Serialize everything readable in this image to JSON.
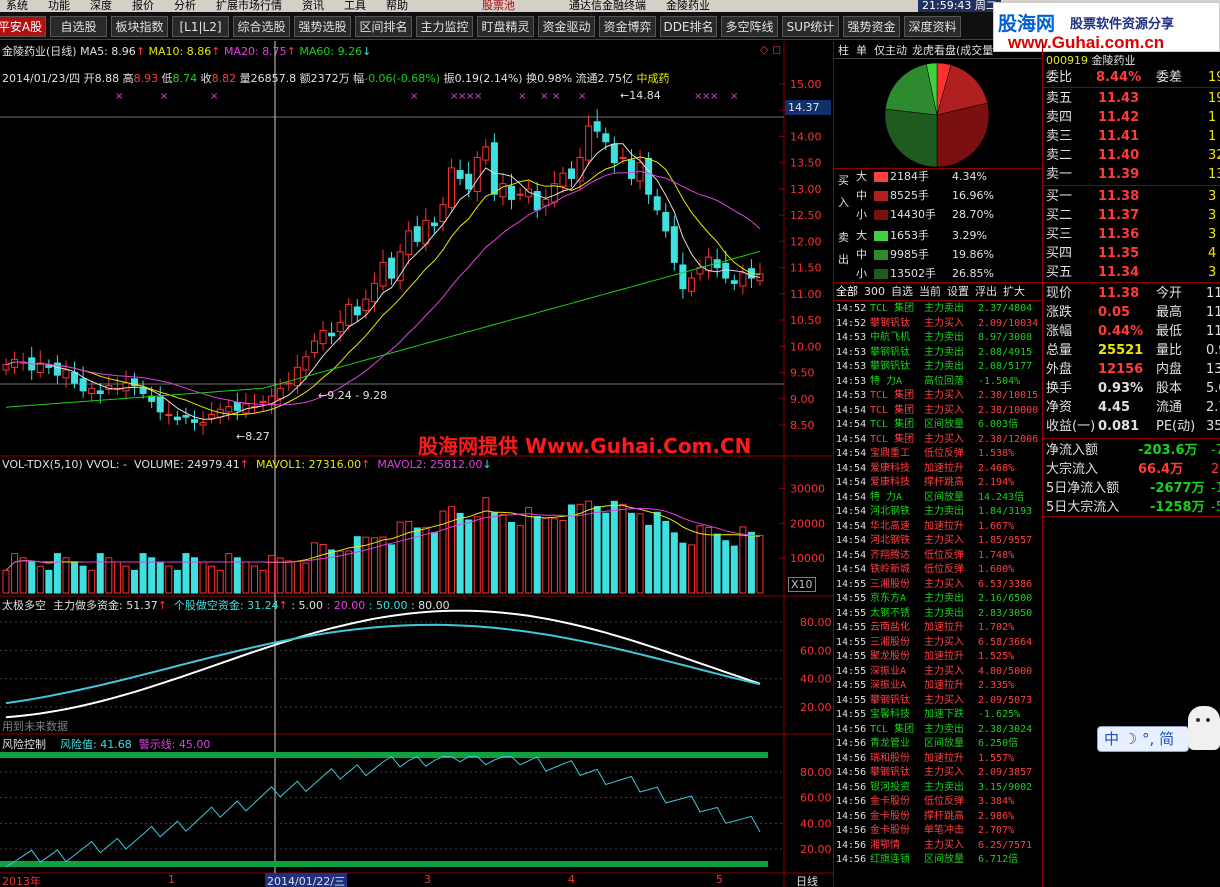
{
  "menu": [
    "系统",
    "功能",
    "深度",
    "报价",
    "分析",
    "扩展市场行情",
    "资讯",
    "工具",
    "帮助"
  ],
  "menu_extra": {
    "center_text": "股票池",
    "app_title": "通达信金融终端",
    "stock": "金陵药业",
    "time": "21:59:43 周二"
  },
  "toolbar": [
    {
      "label": "平安A股",
      "red": true
    },
    {
      "label": "自选股"
    },
    {
      "label": "板块指数"
    },
    {
      "label": "[L1|L2]"
    },
    {
      "label": "综合选股"
    },
    {
      "label": "强势选股"
    },
    {
      "label": "区间排名"
    },
    {
      "label": "主力监控"
    },
    {
      "label": "盯盘精灵"
    },
    {
      "label": "资金驱动"
    },
    {
      "label": "资金博弈"
    },
    {
      "label": "DDE排名"
    },
    {
      "label": "多空阵线"
    },
    {
      "label": "SUP统计"
    },
    {
      "label": "强势资金"
    },
    {
      "label": "深度资料"
    }
  ],
  "brand": {
    "name": "股海网",
    "slogan": "股票软件资源分享",
    "url": "www.Guhai.com.cn"
  },
  "watermark": "股海网提供 Www.Guhai.Com.CN",
  "main_chart": {
    "title": "金陵药业(日线)",
    "ma": [
      {
        "label": "MA5: 8.96",
        "color": "#e0e0e0"
      },
      {
        "label": "MA10: 8.86",
        "color": "#e8e800"
      },
      {
        "label": "MA20: 8.75",
        "color": "#e040e0"
      },
      {
        "label": "MA60: 9.26",
        "color": "#19d219"
      }
    ],
    "date_info": "2014/01/23/四",
    "ohlc": [
      {
        "label": "开",
        "value": "8.88"
      },
      {
        "label": "高",
        "value": "8.93"
      },
      {
        "label": "低",
        "value": "8.74"
      },
      {
        "label": "收",
        "value": "8.82"
      }
    ],
    "vol_label": "量",
    "vol": "26857.8",
    "amount_label": "额",
    "amount": "2372万",
    "change_label": "幅",
    "change": "-0.06(-0.68%)",
    "amp_label": "振",
    "amp": "0.19(2.14%)",
    "turnover_label": "换",
    "turnover": "0.98%",
    "float_label": "流通",
    "float": "2.75亿",
    "extra": "中成药",
    "y_ticks": [
      "15.00",
      "14.50",
      "14.00",
      "13.50",
      "13.00",
      "12.50",
      "12.00",
      "11.50",
      "11.00",
      "10.50",
      "10.00",
      "9.50",
      "9.00",
      "8.50"
    ],
    "last_price": "14.37",
    "annotations": [
      "14.84",
      "9.24 - 9.28",
      "8.27"
    ]
  },
  "volume_chart": {
    "title": "VOL-TDX(5,10)",
    "vvol": "VVOL: -",
    "volume": "VOLUME: 24979.41",
    "mavol1": "MAVOL1: 27316.00",
    "mavol2": "MAVOL2: 25812.00",
    "y_ticks": [
      "30000",
      "20000",
      "10000"
    ],
    "unit": "X10"
  },
  "tj_chart": {
    "title": "太极多空",
    "main": "主力做多资金: 51.37",
    "stock": "个股做空资金: 31.24",
    "levels": [
      ": 5.00",
      ": 20.00",
      ": 50.00",
      ": 80.00"
    ],
    "y_ticks": [
      "80.00",
      "60.00",
      "40.00",
      "20.00"
    ],
    "note": "用到未来数据"
  },
  "risk_chart": {
    "title": "风险控制",
    "risk": "风险值: 41.68",
    "warn": "警示线: 45.00",
    "y_ticks": [
      "80.00",
      "60.00",
      "40.00",
      "20.00"
    ]
  },
  "x_axis": {
    "labels": [
      "2013年",
      "1",
      "2014/01/22/三",
      "3",
      "4",
      "5"
    ],
    "period": "日线"
  },
  "right_tabs": [
    "柱",
    "单",
    "仅主动",
    "龙虎看盘(成交量"
  ],
  "pie_chart": {
    "type": "pie",
    "slices": [
      {
        "name": "买大",
        "value": 4.34,
        "color": "#ff3030"
      },
      {
        "name": "买中",
        "value": 16.96,
        "color": "#b02020"
      },
      {
        "name": "买小",
        "value": 28.7,
        "color": "#7a1010"
      },
      {
        "name": "卖小",
        "value": 26.85,
        "color": "#1f5a1f"
      },
      {
        "name": "卖中",
        "value": 19.86,
        "color": "#2e8a2e"
      },
      {
        "name": "卖大",
        "value": 3.29,
        "color": "#40d040"
      }
    ]
  },
  "flow": {
    "buy_label": "买入",
    "sell_label": "卖出",
    "rows": [
      {
        "size": "大",
        "lots": "2184手",
        "pct": "4.34%",
        "color": "#ff4040"
      },
      {
        "size": "中",
        "lots": "8525手",
        "pct": "16.96%",
        "color": "#b02020"
      },
      {
        "size": "小",
        "lots": "14430手",
        "pct": "28.70%",
        "color": "#7a1010"
      },
      {
        "size": "大",
        "lots": "1653手",
        "pct": "3.29%",
        "color": "#40d040"
      },
      {
        "size": "中",
        "lots": "9985手",
        "pct": "19.86%",
        "color": "#2e8a2e"
      },
      {
        "size": "小",
        "lots": "13502手",
        "pct": "26.85%",
        "color": "#1f5a1f"
      }
    ]
  },
  "filter_tabs": [
    "全部",
    "300",
    "自选",
    "当前",
    "设置",
    "浮出",
    "扩大"
  ],
  "ticks": [
    {
      "t": "14:52",
      "name": "TCL 集团",
      "type": "主力卖出",
      "val": "2.37/4804",
      "c": "g"
    },
    {
      "t": "14:52",
      "name": "攀钢钒钛",
      "type": "主力买入",
      "val": "2.09/10034",
      "c": "r"
    },
    {
      "t": "14:53",
      "name": "中航飞机",
      "type": "主力卖出",
      "val": "8.97/3008",
      "c": "g"
    },
    {
      "t": "14:53",
      "name": "攀钢钒钛",
      "type": "主力卖出",
      "val": "2.08/4915",
      "c": "g"
    },
    {
      "t": "14:53",
      "name": "攀钢钒钛",
      "type": "主力卖出",
      "val": "2.08/5177",
      "c": "g"
    },
    {
      "t": "14:53",
      "name": "特 力A",
      "type": "高位回落",
      "val": "-1.504%",
      "c": "g"
    },
    {
      "t": "14:53",
      "name": "TCL 集团",
      "type": "主力买入",
      "val": "2.38/10015",
      "c": "r"
    },
    {
      "t": "14:54",
      "name": "TCL 集团",
      "type": "主力买入",
      "val": "2.38/10000",
      "c": "r"
    },
    {
      "t": "14:54",
      "name": "TCL 集团",
      "type": "区间放量",
      "val": "6.003倍",
      "c": "g"
    },
    {
      "t": "14:54",
      "name": "TCL 集团",
      "type": "主力买入",
      "val": "2.38/12006",
      "c": "r"
    },
    {
      "t": "14:54",
      "name": "宝鼎重工",
      "type": "低位反弹",
      "val": "1.538%",
      "c": "r"
    },
    {
      "t": "14:54",
      "name": "爱康科技",
      "type": "加速拉升",
      "val": "2.468%",
      "c": "r"
    },
    {
      "t": "14:54",
      "name": "爱康科技",
      "type": "撑杆跳高",
      "val": "2.194%",
      "c": "r"
    },
    {
      "t": "14:54",
      "name": "特 力A",
      "type": "区间放量",
      "val": "14.243倍",
      "c": "g"
    },
    {
      "t": "14:54",
      "name": "河北钢铁",
      "type": "主力卖出",
      "val": "1.84/3193",
      "c": "g"
    },
    {
      "t": "14:54",
      "name": "华北高速",
      "type": "加速拉升",
      "val": "1.667%",
      "c": "r"
    },
    {
      "t": "14:54",
      "name": "河北钢铁",
      "type": "主力买入",
      "val": "1.85/9557",
      "c": "r"
    },
    {
      "t": "14:54",
      "name": "齐翔腾达",
      "type": "低位反弹",
      "val": "1.748%",
      "c": "r"
    },
    {
      "t": "14:54",
      "name": "铁岭新城",
      "type": "低位反弹",
      "val": "1.600%",
      "c": "r"
    },
    {
      "t": "14:55",
      "name": "三湘股份",
      "type": "主力买入",
      "val": "6.53/3386",
      "c": "r"
    },
    {
      "t": "14:55",
      "name": "京东方A",
      "type": "主力卖出",
      "val": "2.16/6500",
      "c": "g"
    },
    {
      "t": "14:55",
      "name": "太钢不锈",
      "type": "主力卖出",
      "val": "2.83/3050",
      "c": "g"
    },
    {
      "t": "14:55",
      "name": "云南盐化",
      "type": "加速拉升",
      "val": "1.702%",
      "c": "r"
    },
    {
      "t": "14:55",
      "name": "三湘股份",
      "type": "主力买入",
      "val": "6.58/3664",
      "c": "r"
    },
    {
      "t": "14:55",
      "name": "聚龙股份",
      "type": "加速拉升",
      "val": "1.525%",
      "c": "r"
    },
    {
      "t": "14:55",
      "name": "深振业A",
      "type": "主力买入",
      "val": "4.80/5000",
      "c": "r"
    },
    {
      "t": "14:55",
      "name": "深振业A",
      "type": "加速拉升",
      "val": "2.335%",
      "c": "r"
    },
    {
      "t": "14:55",
      "name": "攀钢钒钛",
      "type": "主力买入",
      "val": "2.09/5073",
      "c": "r"
    },
    {
      "t": "14:55",
      "name": "宝馨科技",
      "type": "加速下跌",
      "val": "-1.625%",
      "c": "g"
    },
    {
      "t": "14:56",
      "name": "TCL 集团",
      "type": "主力卖出",
      "val": "2.38/3024",
      "c": "g"
    },
    {
      "t": "14:56",
      "name": "青龙管业",
      "type": "区间放量",
      "val": "6.250倍",
      "c": "g"
    },
    {
      "t": "14:56",
      "name": "瑞和股份",
      "type": "加速拉升",
      "val": "1.557%",
      "c": "r"
    },
    {
      "t": "14:56",
      "name": "攀钢钒钛",
      "type": "主力买入",
      "val": "2.09/3857",
      "c": "r"
    },
    {
      "t": "14:56",
      "name": "银河投资",
      "type": "主力卖出",
      "val": "3.15/9002",
      "c": "g"
    },
    {
      "t": "14:56",
      "name": "金卡股份",
      "type": "低位反弹",
      "val": "3.384%",
      "c": "r"
    },
    {
      "t": "14:56",
      "name": "金卡股份",
      "type": "撑杆跳高",
      "val": "2.986%",
      "c": "r"
    },
    {
      "t": "14:56",
      "name": "金卡股份",
      "type": "单笔冲击",
      "val": "2.707%",
      "c": "r"
    },
    {
      "t": "14:56",
      "name": "湘鄂情",
      "type": "主力买入",
      "val": "6.25/7571",
      "c": "r"
    },
    {
      "t": "14:56",
      "name": "红旗连锁",
      "type": "区间放量",
      "val": "6.712倍",
      "c": "g"
    }
  ],
  "quote_header": {
    "code": "000919",
    "name": "金陵药业"
  },
  "quote": {
    "webi": {
      "label": "委比",
      "value": "8.44%",
      "label2": "委差",
      "value2": "19"
    },
    "sell": [
      {
        "label": "卖五",
        "price": "11.43",
        "vol": "19"
      },
      {
        "label": "卖四",
        "price": "11.42",
        "vol": "1"
      },
      {
        "label": "卖三",
        "price": "11.41",
        "vol": "1"
      },
      {
        "label": "卖二",
        "price": "11.40",
        "vol": "32"
      },
      {
        "label": "卖一",
        "price": "11.39",
        "vol": "13"
      }
    ],
    "buy": [
      {
        "label": "买一",
        "price": "11.38",
        "vol": "3"
      },
      {
        "label": "买二",
        "price": "11.37",
        "vol": "3"
      },
      {
        "label": "买三",
        "price": "11.36",
        "vol": "3"
      },
      {
        "label": "买四",
        "price": "11.35",
        "vol": "4"
      },
      {
        "label": "买五",
        "price": "11.34",
        "vol": "3"
      }
    ],
    "stats": [
      {
        "l": "现价",
        "v": "11.38",
        "l2": "今开",
        "v2": "11."
      },
      {
        "l": "涨跌",
        "v": "0.05",
        "l2": "最高",
        "v2": "11."
      },
      {
        "l": "涨幅",
        "v": "0.44%",
        "l2": "最低",
        "v2": "11.3"
      },
      {
        "l": "总量",
        "v": "25521",
        "l2": "量比",
        "v2": "0.9"
      },
      {
        "l": "外盘",
        "v": "12156",
        "l2": "内盘",
        "v2": "1336"
      },
      {
        "l": "换手",
        "v": "0.93%",
        "l2": "股本",
        "v2": "5.04"
      },
      {
        "l": "净资",
        "v": "4.45",
        "l2": "流通",
        "v2": "2.75"
      },
      {
        "l": "收益(一)",
        "v": "0.081",
        "l2": "PE(动)",
        "v2": "35"
      }
    ],
    "flow": [
      {
        "l": "净流入额",
        "v": "-203.6万",
        "v2": "-7"
      },
      {
        "l": "大宗流入",
        "v": "66.4万",
        "v2": "2"
      },
      {
        "l": "5日净流入额",
        "v": "-2677万",
        "v2": "-11"
      },
      {
        "l": "5日大宗流入",
        "v": "-1258万",
        "v2": "-5"
      }
    ]
  },
  "lang_widget": {
    "label": "中",
    "mode": "简"
  }
}
